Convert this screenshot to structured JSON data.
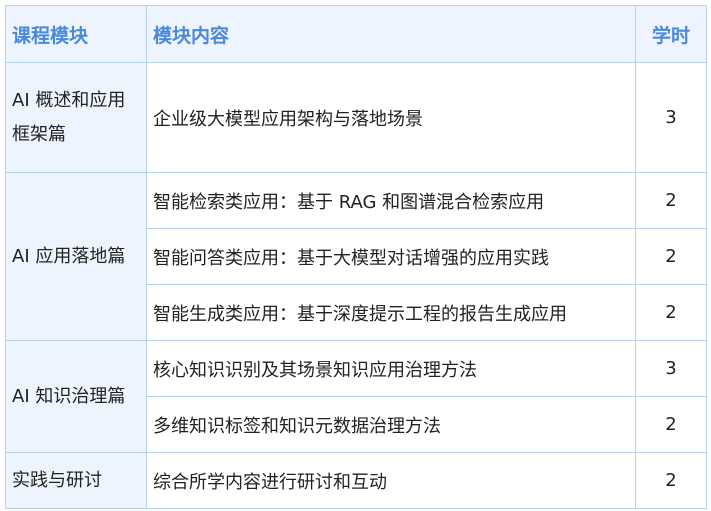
{
  "headers": {
    "module": "课程模块",
    "content": "模块内容",
    "hours": "学时"
  },
  "modules": [
    {
      "name": "AI 概述和应用框架篇",
      "items": [
        {
          "content": "企业级大模型应用架构与落地场景",
          "hours": "3"
        }
      ]
    },
    {
      "name": "AI 应用落地篇",
      "items": [
        {
          "content": "智能检索类应用：基于 RAG 和图谱混合检索应用",
          "hours": "2"
        },
        {
          "content": "智能问答类应用：基于大模型对话增强的应用实践",
          "hours": "2"
        },
        {
          "content": "智能生成类应用：基于深度提示工程的报告生成应用",
          "hours": "2"
        }
      ]
    },
    {
      "name": "AI 知识治理篇",
      "items": [
        {
          "content": "核心知识识别及其场景知识应用治理方法",
          "hours": "3"
        },
        {
          "content": "多维知识标签和知识元数据治理方法",
          "hours": "2"
        }
      ]
    },
    {
      "name": "实践与研讨",
      "items": [
        {
          "content": "综合所学内容进行研讨和互动",
          "hours": "2"
        }
      ]
    }
  ],
  "colors": {
    "header_text": "#4a8ad8",
    "module_bg": "#edf4fd",
    "border": "#b8d1ec"
  }
}
